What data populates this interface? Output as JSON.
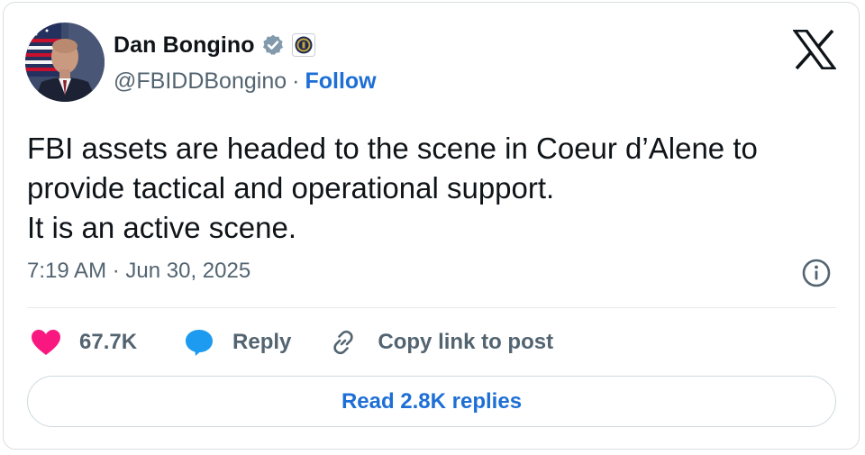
{
  "author": {
    "name": "Dan Bongino",
    "handle": "@FBIDDBongino",
    "separator": "·",
    "follow_label": "Follow",
    "avatar_icon": "profile-photo",
    "verified_icon": "verified-badge-icon",
    "affiliation_icon": "fbi-seal-icon"
  },
  "platform": {
    "logo_icon": "x-logo-icon"
  },
  "tweet": {
    "lines": [
      "FBI assets are headed to the scene in Coeur d’Alene to",
      "provide tactical and operational support.",
      "It is an active scene."
    ],
    "timestamp": "7:19 AM · Jun 30, 2025",
    "info_icon": "info-icon"
  },
  "actions": {
    "like_count": "67.7K",
    "reply_label": "Reply",
    "copy_link_label": "Copy link to post"
  },
  "footer": {
    "read_replies_label": "Read 2.8K replies"
  },
  "colors": {
    "accent": "#1d6fd6",
    "like": "#f91880",
    "reply_bubble": "#1d9bf0",
    "muted_text": "#536471",
    "primary_text": "#0f1419",
    "border": "#cfd9de"
  }
}
